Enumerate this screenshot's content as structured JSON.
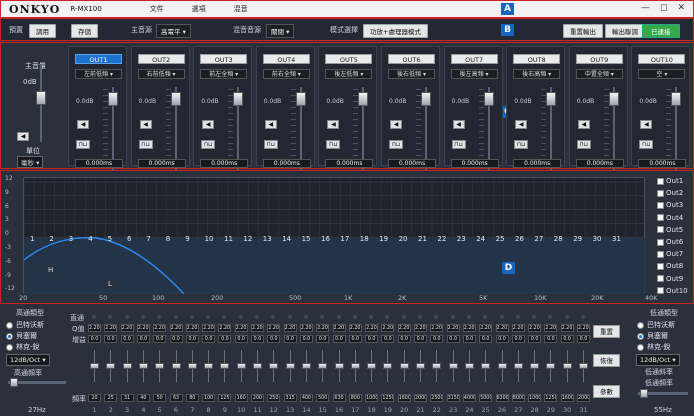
{
  "titlebar": {
    "logo": "ONKYO",
    "model": "R-MX100",
    "menus": [
      "文件",
      "選項",
      "混音"
    ],
    "marker": "A",
    "min": "—",
    "max": "◻",
    "close": "✕"
  },
  "toolbar": {
    "preset_label": "預置",
    "use_btn": "調用",
    "save_btn": "存儲",
    "main_source_label": "主音源",
    "main_source_value": "高電平",
    "mix_source_label": "混音音源",
    "mix_source_value": "關閉",
    "mode_label": "模式選擇",
    "mode_value": "功放+處理器模式",
    "marker": "B",
    "reset_btn": "重置輸出",
    "output_link_btn": "輸出聯調",
    "connected_btn": "已連接"
  },
  "master": {
    "label": "主音量",
    "db": "0dB",
    "unit_label": "單位",
    "unit_value": "毫秒"
  },
  "channels": [
    {
      "name": "OUT1",
      "position": "左前低頻",
      "db": "0.0dB",
      "delay": "0.000ms",
      "active": true
    },
    {
      "name": "OUT2",
      "position": "右前低頻",
      "db": "0.0dB",
      "delay": "0.000ms",
      "active": false
    },
    {
      "name": "OUT3",
      "position": "前左全頻",
      "db": "0.0dB",
      "delay": "0.000ms",
      "active": false
    },
    {
      "name": "OUT4",
      "position": "前右全頻",
      "db": "0.0dB",
      "delay": "0.000ms",
      "active": false
    },
    {
      "name": "OUT5",
      "position": "後左低頻",
      "db": "0.0dB",
      "delay": "0.000ms",
      "active": false
    },
    {
      "name": "OUT6",
      "position": "後右低頻",
      "db": "0.0dB",
      "delay": "0.000ms",
      "active": false
    },
    {
      "name": "OUT7",
      "position": "後左高頻",
      "db": "0.0dB",
      "delay": "0.000ms",
      "active": false
    },
    {
      "name": "OUT8",
      "position": "後右高頻",
      "db": "0.0dB",
      "delay": "0.000ms",
      "active": false
    },
    {
      "name": "OUT9",
      "position": "中置全頻",
      "db": "0.0dB",
      "delay": "0.000ms",
      "active": false
    },
    {
      "name": "OUT10",
      "position": "空",
      "db": "0.0dB",
      "delay": "0.000ms",
      "active": false
    }
  ],
  "strips_marker": "C",
  "graph": {
    "marker": "D",
    "y_ticks": [
      "12",
      "9",
      "6",
      "3",
      "0",
      "-3",
      "-6",
      "-9",
      "-12"
    ],
    "x_ticks": [
      "20",
      "50",
      "100",
      "200",
      "500",
      "1K",
      "2K",
      "5K",
      "10K",
      "20K",
      "40K"
    ],
    "band_labels": [
      "1",
      "2",
      "3",
      "4",
      "5",
      "6",
      "7",
      "8",
      "9",
      "10",
      "11",
      "12",
      "13",
      "14",
      "15",
      "16",
      "17",
      "18",
      "19",
      "20",
      "21",
      "22",
      "23",
      "24",
      "25",
      "26",
      "27",
      "28",
      "29",
      "30",
      "31"
    ],
    "h_label": "H",
    "l_label": "L",
    "legend": [
      "Out1",
      "Out2",
      "Out3",
      "Out4",
      "Out5",
      "Out6",
      "Out7",
      "Out8",
      "Out9",
      "Out10"
    ]
  },
  "hp": {
    "title": "高通類型",
    "types": [
      "巴特沃斯",
      "貝塞爾",
      "林克-銳"
    ],
    "selected": 1,
    "slope": "12dB/Oct",
    "freq_label": "高通頻率",
    "freq_value": "27Hz"
  },
  "lp": {
    "title": "低通類型",
    "types": [
      "巴特沃斯",
      "貝塞爾",
      "林克-銳"
    ],
    "selected": 1,
    "slope": "12dB/Oct",
    "slope_label": "低通斜率",
    "freq_label": "低通頻率",
    "freq_value": "55Hz"
  },
  "eq": {
    "row_labels": [
      "直通",
      "Q值",
      "增益",
      "頻率"
    ],
    "q_values": [
      "2.201",
      "2.201",
      "2.201",
      "2.201",
      "2.201",
      "2.201",
      "2.201",
      "2.201",
      "2.201",
      "2.201",
      "2.201",
      "2.201",
      "2.201",
      "2.201",
      "2.201",
      "2.201",
      "2.201",
      "2.201",
      "2.201",
      "2.201",
      "2.201",
      "2.201",
      "2.201",
      "2.201",
      "2.201",
      "2.201",
      "2.201",
      "2.201",
      "2.201",
      "2.201",
      "2.201"
    ],
    "gains": [
      "0.0",
      "0.0",
      "0.0",
      "0.0",
      "0.0",
      "0.0",
      "0.0",
      "0.0",
      "0.0",
      "0.0",
      "0.0",
      "0.0",
      "0.0",
      "0.0",
      "0.0",
      "0.0",
      "0.0",
      "0.0",
      "0.0",
      "0.0",
      "0.0",
      "0.0",
      "0.0",
      "0.0",
      "0.0",
      "0.0",
      "0.0",
      "0.0",
      "0.0",
      "0.0",
      "0.0"
    ],
    "freqs": [
      "20",
      "25",
      "31",
      "40",
      "50",
      "63",
      "80",
      "100",
      "125",
      "160",
      "200",
      "250",
      "315",
      "400",
      "500",
      "630",
      "800",
      "1000",
      "1250",
      "1600",
      "2000",
      "2500",
      "3150",
      "4000",
      "5000",
      "6300",
      "8000",
      "10000",
      "12500",
      "16000",
      "20000"
    ],
    "band_numbers": [
      "1",
      "2",
      "3",
      "4",
      "5",
      "6",
      "7",
      "8",
      "9",
      "10",
      "11",
      "12",
      "13",
      "14",
      "15",
      "16",
      "17",
      "18",
      "19",
      "20",
      "21",
      "22",
      "23",
      "24",
      "25",
      "26",
      "27",
      "28",
      "29",
      "30",
      "31"
    ],
    "reset_btn": "重置",
    "restore_btn": "恢復",
    "params_btn": "參數"
  }
}
